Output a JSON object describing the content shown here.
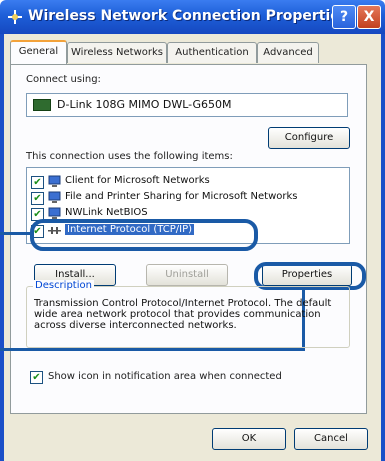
{
  "window": {
    "title": "Wireless Network Connection Properties",
    "help_label": "?",
    "close_label": "X"
  },
  "tabs": [
    {
      "label": "General"
    },
    {
      "label": "Wireless Networks"
    },
    {
      "label": "Authentication"
    },
    {
      "label": "Advanced"
    }
  ],
  "general": {
    "connect_using_label": "Connect using:",
    "adapter_name": "D-Link 108G MIMO DWL-G650M",
    "configure_label": "Configure",
    "items_label": "This connection uses the following items:",
    "items": [
      {
        "label": "Client for Microsoft Networks",
        "checked": "✔"
      },
      {
        "label": "File and Printer Sharing for Microsoft Networks",
        "checked": "✔"
      },
      {
        "label": "NWLink NetBIOS",
        "checked": "✔"
      },
      {
        "label": "Internet Protocol (TCP/IP)",
        "checked": "✔"
      }
    ],
    "install_label": "Install...",
    "uninstall_label": "Uninstall",
    "properties_label": "Properties",
    "description_title": "Description",
    "description_text": "Transmission Control Protocol/Internet Protocol. The default wide area network protocol that provides communication across diverse interconnected networks.",
    "show_icon_label": "Show icon in notification area when connected",
    "show_icon_check": "✔"
  },
  "footer": {
    "ok_label": "OK",
    "cancel_label": "Cancel"
  },
  "colors": {
    "title_bar": "#1e5fd8",
    "highlight_ring": "#1a5aa6",
    "selection": "#316ac5"
  }
}
